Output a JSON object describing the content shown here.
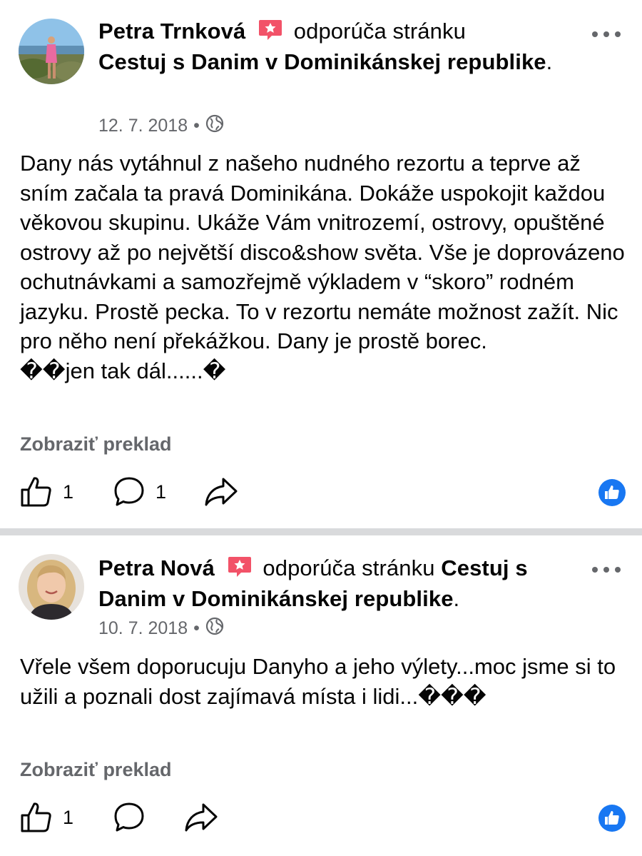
{
  "posts": [
    {
      "author": "Petra Trnková",
      "verb": "odporúča stránku",
      "page": "Cestuj s Danim v Dominikánskej republike",
      "period": ".",
      "date": "12. 7. 2018",
      "separator": "•",
      "body": "Dany nás vytáhnul z našeho nudného rezortu a teprve až sním začala ta pravá Dominikána. Dokáže uspokojit každou věkovou skupinu. Ukáže Vám vnitrozemí, ostrovy, opuštěné ostrovy až po největší disco&show světa. Vše je doprovázeno ochutnávkami a samozřejmě výkladem v “skoro” rodném jazyku. Prostě pecka. To v rezortu nemáte možnost zažít. Nic pro něho není překážkou. Dany je prostě borec.\n��jen tak dál......�",
      "translate": "Zobraziť preklad",
      "like_count": "1",
      "comment_count": "1"
    },
    {
      "author": "Petra Nová",
      "verb": "odporúča stránku",
      "page": "Cestuj s Danim v Dominikánskej republike",
      "period": ".",
      "date": "10. 7. 2018",
      "separator": "•",
      "body": "Vřele všem doporucuju Danyho a jeho výlety...moc jsme si to užili a poznali dost zajímavá místa i lidi...���",
      "translate": "Zobraziť preklad",
      "like_count": "1",
      "comment_count": ""
    }
  ],
  "colors": {
    "recommend": "#f25268",
    "like_blue": "#1877f2",
    "secondary_text": "#65676b",
    "divider": "#d9dadc"
  },
  "icons": [
    "recommend-icon",
    "globe-icon",
    "more-icon",
    "like-icon",
    "comment-icon",
    "share-icon",
    "like-reaction-icon"
  ]
}
